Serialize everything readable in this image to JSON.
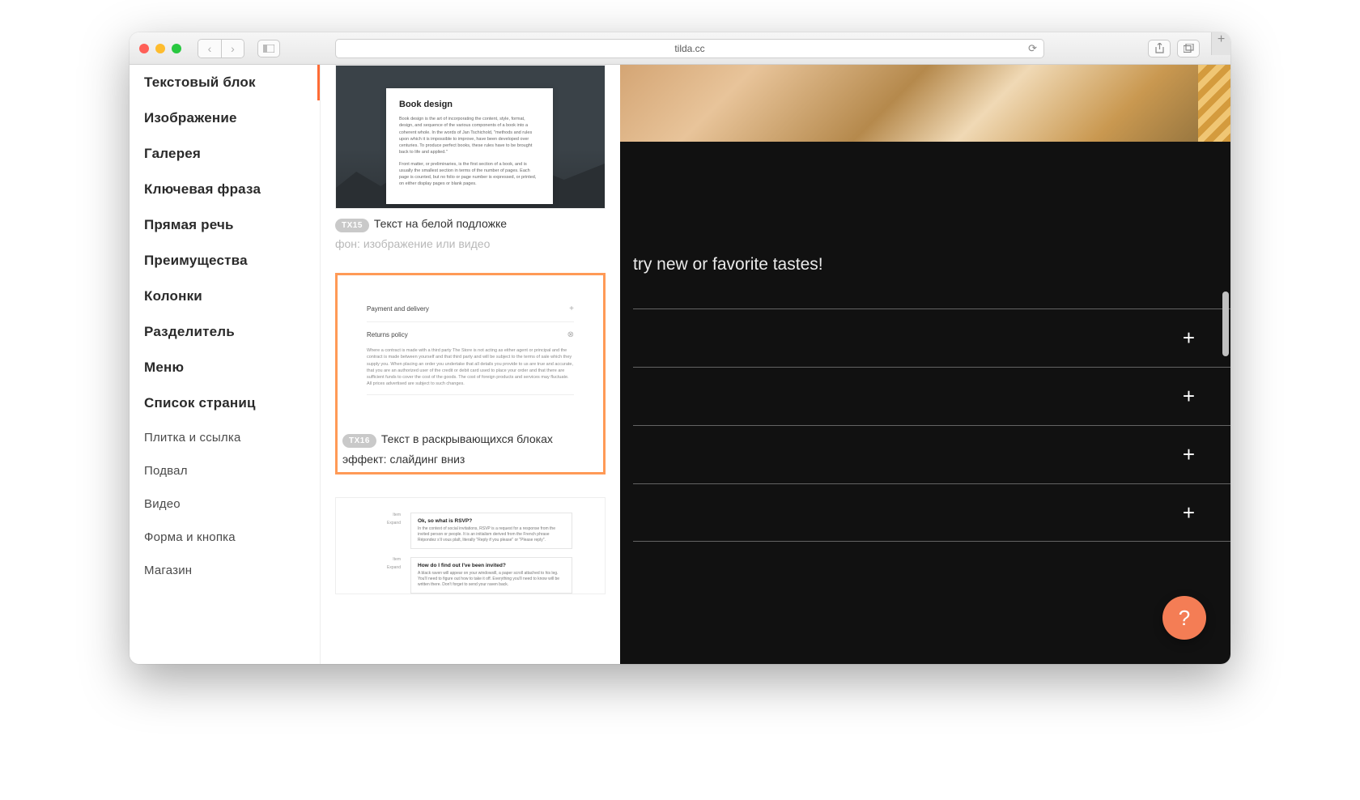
{
  "browser": {
    "url": "tilda.cc"
  },
  "sidebar": {
    "items": [
      {
        "label": "Текстовый блок",
        "active": true,
        "primary": true
      },
      {
        "label": "Изображение",
        "primary": true
      },
      {
        "label": "Галерея",
        "primary": true
      },
      {
        "label": "Ключевая фраза",
        "primary": true
      },
      {
        "label": "Прямая речь",
        "primary": true
      },
      {
        "label": "Преимущества",
        "primary": true
      },
      {
        "label": "Колонки",
        "primary": true
      },
      {
        "label": "Разделитель",
        "primary": true
      },
      {
        "label": "Меню",
        "primary": true
      },
      {
        "label": "Список страниц",
        "primary": true
      },
      {
        "label": "Плитка и ссылка",
        "primary": false
      },
      {
        "label": "Подвал",
        "primary": false
      },
      {
        "label": "Видео",
        "primary": false
      },
      {
        "label": "Форма и кнопка",
        "primary": false
      },
      {
        "label": "Магазин",
        "primary": false
      }
    ]
  },
  "blocks": {
    "tx15": {
      "code": "TX15",
      "title": "Текст на белой подложке",
      "muted": "фон: изображение или видео",
      "card_title": "Book design",
      "card_p1": "Book design is the art of incorporating the content, style, format, design, and sequence of the various components of a book into a coherent whole. In the words of Jan Tschichold, \"methods and rules upon which it is impossible to improve, have been developed over centuries. To produce perfect books, these rules have to be brought back to life and applied.\"",
      "card_p2": "Front matter, or preliminaries, is the first section of a book, and is usually the smallest section in terms of the number of pages. Each page is counted, but no folio or page number is expressed, or printed, on either display pages or blank pages."
    },
    "tx16": {
      "code": "TX16",
      "title": "Текст в раскрывающихся блоках",
      "muted": "эффект: слайдинг вниз",
      "row1": "Payment and delivery",
      "row2": "Returns policy",
      "body": "Where a contract is made with a third party The Store is not acting as either agent or principal and the contract is made between yourself and that third party and will be subject to the terms of sale which they supply you. When placing an order you undertake that all details you provide to us are true and accurate, that you are an authorized user of the credit or debit card used to place your order and that there are sufficient funds to cover the cost of the goods. The cost of foreign products and services may fluctuate. All prices advertised are subject to such changes."
    },
    "tx17": {
      "faq1_q": "Ok, so what is RSVP?",
      "faq1_a": "In the context of social invitations, RSVP is a request for a response from the invited person or people. It is an initialism derived from the French phrase Répondez s'il vous plaît, literally \"Reply if you please\" or \"Please reply\".",
      "faq2_q": "How do I find out I've been invited?",
      "faq2_a": "A black raven will appear on your windowsill, a paper scroll attached to his leg. You'll need to figure out how to take it off. Everything you'll need to know will be written there. Don't forget to send your raven back.",
      "left_label1": "Item",
      "left_label2": "Expand"
    }
  },
  "page": {
    "tagline": "try new or favorite tastes!"
  },
  "help": {
    "label": "?"
  }
}
